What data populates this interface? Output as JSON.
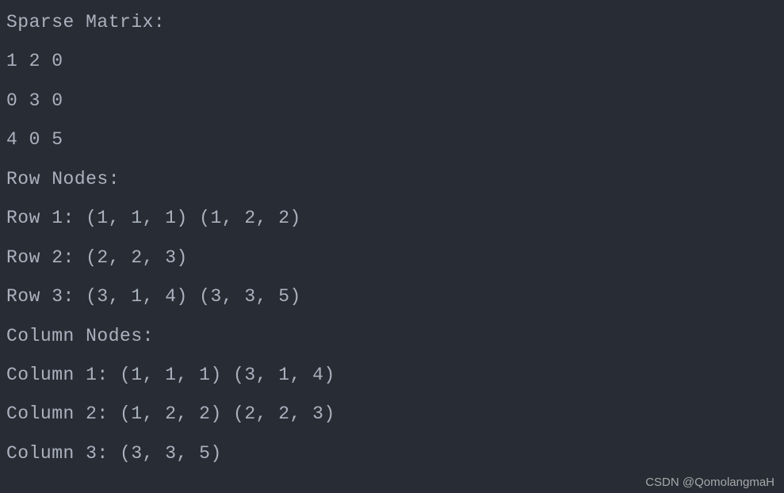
{
  "terminal": {
    "lines": [
      "Sparse Matrix:",
      "1 2 0",
      "0 3 0",
      "4 0 5",
      "Row Nodes:",
      "Row 1: (1, 1, 1) (1, 2, 2)",
      "Row 2: (2, 2, 3)",
      "Row 3: (3, 1, 4) (3, 3, 5)",
      "Column Nodes:",
      "Column 1: (1, 1, 1) (3, 1, 4)",
      "Column 2: (1, 2, 2) (2, 2, 3)",
      "Column 3: (3, 3, 5)"
    ]
  },
  "watermark": "CSDN @QomolangmaH"
}
